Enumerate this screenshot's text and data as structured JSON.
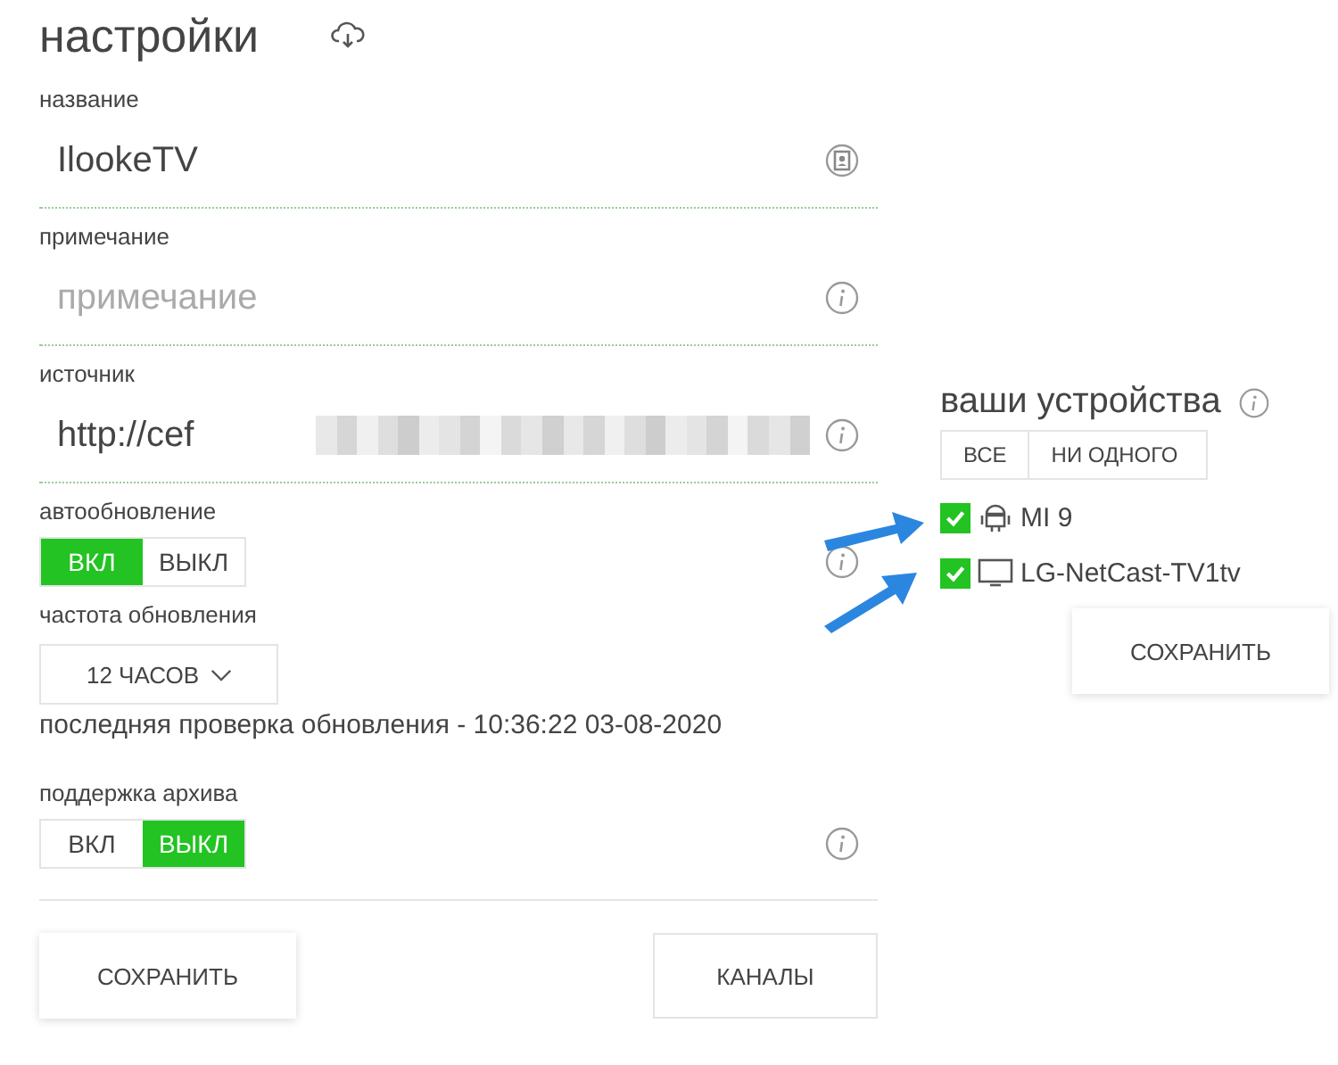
{
  "title": "настройки",
  "fields": [
    {
      "label": "название",
      "value": "IlookeTV"
    },
    {
      "label": "примечание",
      "placeholder": "примечание"
    },
    {
      "label": "источник",
      "value": "http://cef",
      "redacted": true
    }
  ],
  "auto_update": {
    "label": "автообновление",
    "options": [
      {
        "label": "ВКЛ",
        "selected": true
      },
      {
        "label": "ВЫКЛ",
        "selected": false
      }
    ]
  },
  "frequency": {
    "label": "частота обновления",
    "value": "12 ЧАСОВ"
  },
  "last_check": "последняя проверка обновления - 10:36:22 03-08-2020",
  "archive": {
    "label": "поддержка архива",
    "options": [
      {
        "label": "ВКЛ",
        "selected": false
      },
      {
        "label": "ВЫКЛ",
        "selected": true
      }
    ]
  },
  "buttons": [
    "СОХРАНИТЬ",
    "КАНАЛЫ"
  ],
  "devices_panel": {
    "title": "ваши устройства",
    "filters": [
      "ВСЕ",
      "НИ ОДНОГО"
    ],
    "devices": [
      {
        "name": "MI 9",
        "kind": "android",
        "checked": true
      },
      {
        "name": "LG-NetCast-TV1tv",
        "kind": "tv",
        "checked": true
      }
    ],
    "save": "СОХРАНИТЬ"
  }
}
